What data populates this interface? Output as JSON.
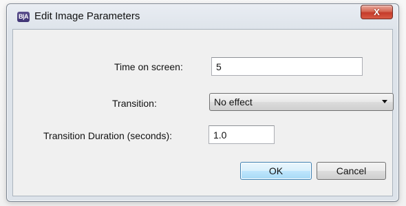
{
  "window": {
    "app_icon_text": "B|A",
    "title": "Edit Image Parameters",
    "close_label": "X"
  },
  "form": {
    "time_on_screen": {
      "label": "Time on screen:",
      "value": "5"
    },
    "transition": {
      "label": "Transition:",
      "selected": "No effect"
    },
    "transition_duration": {
      "label": "Transition Duration (seconds):",
      "value": "1.0"
    }
  },
  "buttons": {
    "ok": "OK",
    "cancel": "Cancel"
  },
  "colors": {
    "default_button_border": "#3c7fb1",
    "close_button": "#c53b2a"
  }
}
